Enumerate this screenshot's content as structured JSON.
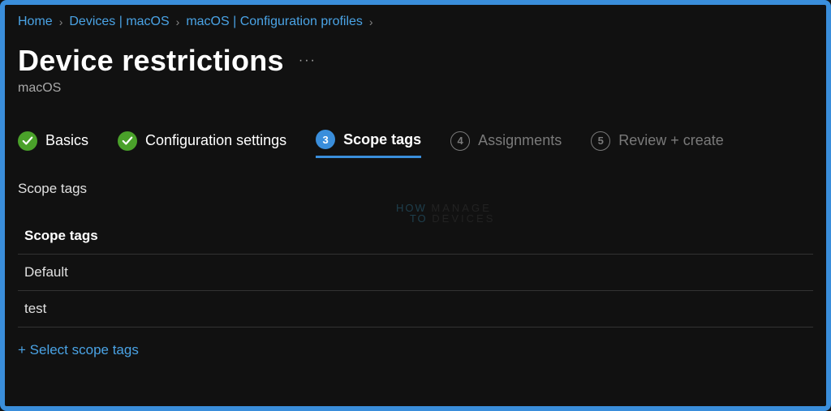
{
  "breadcrumb": [
    {
      "label": "Home"
    },
    {
      "label": "Devices | macOS"
    },
    {
      "label": "macOS | Configuration profiles"
    }
  ],
  "page": {
    "title": "Device restrictions",
    "subtitle": "macOS",
    "ellipsis": "···"
  },
  "wizard": {
    "steps": [
      {
        "label": "Basics",
        "state": "done"
      },
      {
        "label": "Configuration settings",
        "state": "done"
      },
      {
        "label": "Scope tags",
        "num": "3",
        "state": "active"
      },
      {
        "label": "Assignments",
        "num": "4",
        "state": "idle"
      },
      {
        "label": "Review + create",
        "num": "5",
        "state": "idle"
      }
    ]
  },
  "scope": {
    "section_label": "Scope tags",
    "table_header": "Scope tags",
    "rows": [
      {
        "value": "Default"
      },
      {
        "value": "test"
      }
    ],
    "select_link": "+ Select scope tags"
  },
  "watermark": {
    "l1": "HOW",
    "l2": "TO",
    "l3": "MANAGE",
    "l4": "DEVICES"
  }
}
